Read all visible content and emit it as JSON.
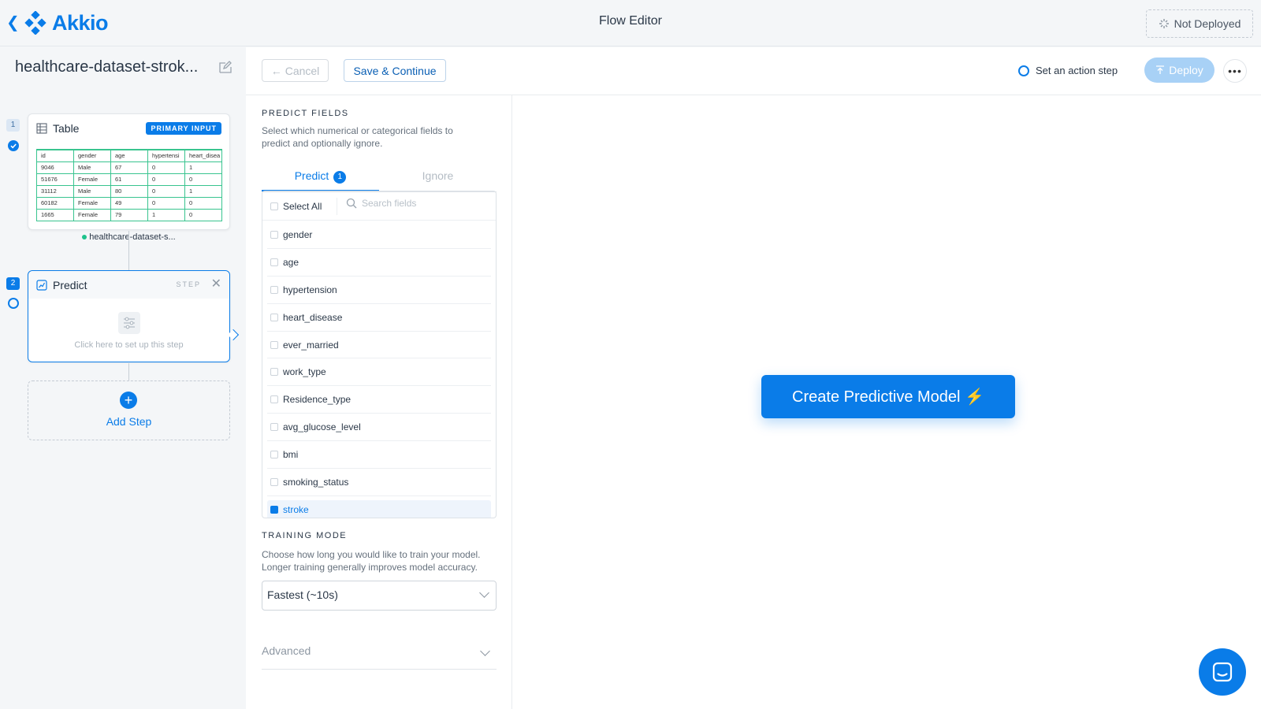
{
  "header": {
    "brand": "Akkio",
    "title": "Flow Editor",
    "deploy_status": "Not Deployed"
  },
  "sidebar": {
    "flow_name": "healthcare-dataset-strok...",
    "steps": [
      {
        "number": "1",
        "title": "Table",
        "badge": "PRIMARY INPUT",
        "table_columns": [
          "id",
          "gender",
          "age",
          "hypertensi",
          "heart_disea"
        ],
        "table_rows": [
          [
            "9046",
            "Male",
            "67",
            "0",
            "1"
          ],
          [
            "51676",
            "Female",
            "61",
            "0",
            "0"
          ],
          [
            "31112",
            "Male",
            "80",
            "0",
            "1"
          ],
          [
            "60182",
            "Female",
            "49",
            "0",
            "0"
          ],
          [
            "1665",
            "Female",
            "79",
            "1",
            "0"
          ]
        ],
        "dataset_label": "healthcare-dataset-s..."
      },
      {
        "number": "2",
        "title": "Predict",
        "tag": "STEP",
        "hint": "Click here to set up this step"
      }
    ],
    "add_step_label": "Add Step"
  },
  "toolbar": {
    "cancel_label": "Cancel",
    "save_label": "Save & Continue",
    "action_step_label": "Set an action step",
    "deploy_label": "Deploy",
    "more_label": "•••"
  },
  "predict_fields": {
    "title": "PREDICT FIELDS",
    "description": "Select which numerical or categorical fields to predict and optionally ignore.",
    "tabs": [
      {
        "label": "Predict",
        "count": "1"
      },
      {
        "label": "Ignore"
      }
    ],
    "select_all_label": "Select All",
    "search_placeholder": "Search fields",
    "fields": [
      "gender",
      "age",
      "hypertension",
      "heart_disease",
      "ever_married",
      "work_type",
      "Residence_type",
      "avg_glucose_level",
      "bmi",
      "smoking_status"
    ],
    "selected_field": "stroke"
  },
  "training_mode": {
    "title": "TRAINING MODE",
    "description": "Choose how long you would like to train your model. Longer training generally improves model accuracy.",
    "selected": "Fastest (~10s)"
  },
  "advanced_label": "Advanced",
  "cta_label": "Create Predictive Model ⚡",
  "colors": {
    "accent": "#0a7ce8",
    "success": "#1ec28b",
    "table_border": "#39c48f"
  }
}
